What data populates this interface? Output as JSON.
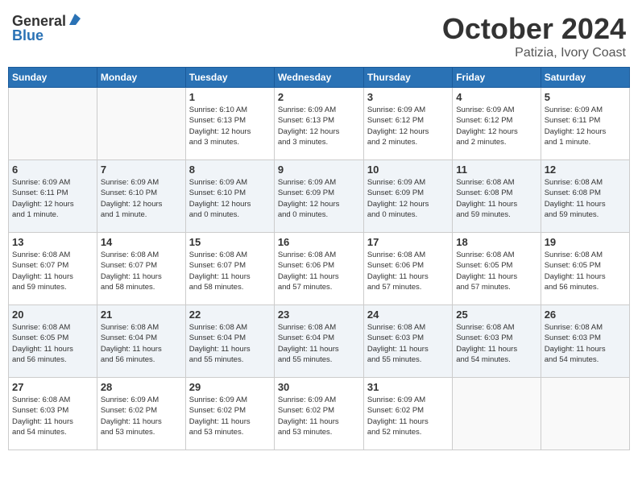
{
  "header": {
    "logo_general": "General",
    "logo_blue": "Blue",
    "month": "October 2024",
    "location": "Patizia, Ivory Coast"
  },
  "days_of_week": [
    "Sunday",
    "Monday",
    "Tuesday",
    "Wednesday",
    "Thursday",
    "Friday",
    "Saturday"
  ],
  "weeks": [
    [
      {
        "day": "",
        "info": ""
      },
      {
        "day": "",
        "info": ""
      },
      {
        "day": "1",
        "info": "Sunrise: 6:10 AM\nSunset: 6:13 PM\nDaylight: 12 hours\nand 3 minutes."
      },
      {
        "day": "2",
        "info": "Sunrise: 6:09 AM\nSunset: 6:13 PM\nDaylight: 12 hours\nand 3 minutes."
      },
      {
        "day": "3",
        "info": "Sunrise: 6:09 AM\nSunset: 6:12 PM\nDaylight: 12 hours\nand 2 minutes."
      },
      {
        "day": "4",
        "info": "Sunrise: 6:09 AM\nSunset: 6:12 PM\nDaylight: 12 hours\nand 2 minutes."
      },
      {
        "day": "5",
        "info": "Sunrise: 6:09 AM\nSunset: 6:11 PM\nDaylight: 12 hours\nand 1 minute."
      }
    ],
    [
      {
        "day": "6",
        "info": "Sunrise: 6:09 AM\nSunset: 6:11 PM\nDaylight: 12 hours\nand 1 minute."
      },
      {
        "day": "7",
        "info": "Sunrise: 6:09 AM\nSunset: 6:10 PM\nDaylight: 12 hours\nand 1 minute."
      },
      {
        "day": "8",
        "info": "Sunrise: 6:09 AM\nSunset: 6:10 PM\nDaylight: 12 hours\nand 0 minutes."
      },
      {
        "day": "9",
        "info": "Sunrise: 6:09 AM\nSunset: 6:09 PM\nDaylight: 12 hours\nand 0 minutes."
      },
      {
        "day": "10",
        "info": "Sunrise: 6:09 AM\nSunset: 6:09 PM\nDaylight: 12 hours\nand 0 minutes."
      },
      {
        "day": "11",
        "info": "Sunrise: 6:08 AM\nSunset: 6:08 PM\nDaylight: 11 hours\nand 59 minutes."
      },
      {
        "day": "12",
        "info": "Sunrise: 6:08 AM\nSunset: 6:08 PM\nDaylight: 11 hours\nand 59 minutes."
      }
    ],
    [
      {
        "day": "13",
        "info": "Sunrise: 6:08 AM\nSunset: 6:07 PM\nDaylight: 11 hours\nand 59 minutes."
      },
      {
        "day": "14",
        "info": "Sunrise: 6:08 AM\nSunset: 6:07 PM\nDaylight: 11 hours\nand 58 minutes."
      },
      {
        "day": "15",
        "info": "Sunrise: 6:08 AM\nSunset: 6:07 PM\nDaylight: 11 hours\nand 58 minutes."
      },
      {
        "day": "16",
        "info": "Sunrise: 6:08 AM\nSunset: 6:06 PM\nDaylight: 11 hours\nand 57 minutes."
      },
      {
        "day": "17",
        "info": "Sunrise: 6:08 AM\nSunset: 6:06 PM\nDaylight: 11 hours\nand 57 minutes."
      },
      {
        "day": "18",
        "info": "Sunrise: 6:08 AM\nSunset: 6:05 PM\nDaylight: 11 hours\nand 57 minutes."
      },
      {
        "day": "19",
        "info": "Sunrise: 6:08 AM\nSunset: 6:05 PM\nDaylight: 11 hours\nand 56 minutes."
      }
    ],
    [
      {
        "day": "20",
        "info": "Sunrise: 6:08 AM\nSunset: 6:05 PM\nDaylight: 11 hours\nand 56 minutes."
      },
      {
        "day": "21",
        "info": "Sunrise: 6:08 AM\nSunset: 6:04 PM\nDaylight: 11 hours\nand 56 minutes."
      },
      {
        "day": "22",
        "info": "Sunrise: 6:08 AM\nSunset: 6:04 PM\nDaylight: 11 hours\nand 55 minutes."
      },
      {
        "day": "23",
        "info": "Sunrise: 6:08 AM\nSunset: 6:04 PM\nDaylight: 11 hours\nand 55 minutes."
      },
      {
        "day": "24",
        "info": "Sunrise: 6:08 AM\nSunset: 6:03 PM\nDaylight: 11 hours\nand 55 minutes."
      },
      {
        "day": "25",
        "info": "Sunrise: 6:08 AM\nSunset: 6:03 PM\nDaylight: 11 hours\nand 54 minutes."
      },
      {
        "day": "26",
        "info": "Sunrise: 6:08 AM\nSunset: 6:03 PM\nDaylight: 11 hours\nand 54 minutes."
      }
    ],
    [
      {
        "day": "27",
        "info": "Sunrise: 6:08 AM\nSunset: 6:03 PM\nDaylight: 11 hours\nand 54 minutes."
      },
      {
        "day": "28",
        "info": "Sunrise: 6:09 AM\nSunset: 6:02 PM\nDaylight: 11 hours\nand 53 minutes."
      },
      {
        "day": "29",
        "info": "Sunrise: 6:09 AM\nSunset: 6:02 PM\nDaylight: 11 hours\nand 53 minutes."
      },
      {
        "day": "30",
        "info": "Sunrise: 6:09 AM\nSunset: 6:02 PM\nDaylight: 11 hours\nand 53 minutes."
      },
      {
        "day": "31",
        "info": "Sunrise: 6:09 AM\nSunset: 6:02 PM\nDaylight: 11 hours\nand 52 minutes."
      },
      {
        "day": "",
        "info": ""
      },
      {
        "day": "",
        "info": ""
      }
    ]
  ]
}
